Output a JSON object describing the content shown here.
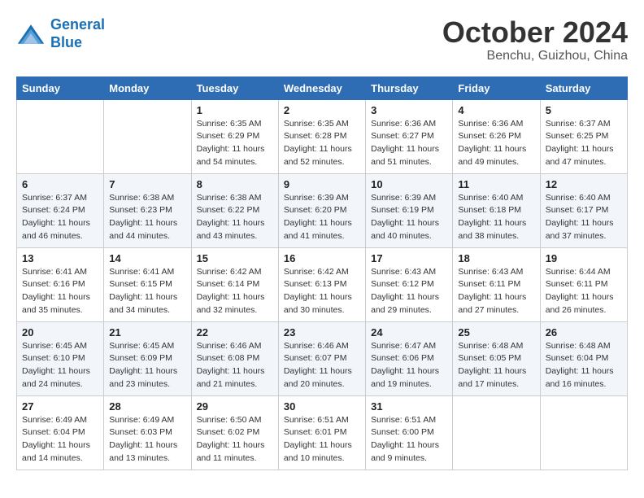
{
  "header": {
    "logo_line1": "General",
    "logo_line2": "Blue",
    "month": "October 2024",
    "location": "Benchu, Guizhou, China"
  },
  "weekdays": [
    "Sunday",
    "Monday",
    "Tuesday",
    "Wednesday",
    "Thursday",
    "Friday",
    "Saturday"
  ],
  "weeks": [
    [
      {
        "day": "",
        "detail": ""
      },
      {
        "day": "",
        "detail": ""
      },
      {
        "day": "1",
        "detail": "Sunrise: 6:35 AM\nSunset: 6:29 PM\nDaylight: 11 hours and 54 minutes."
      },
      {
        "day": "2",
        "detail": "Sunrise: 6:35 AM\nSunset: 6:28 PM\nDaylight: 11 hours and 52 minutes."
      },
      {
        "day": "3",
        "detail": "Sunrise: 6:36 AM\nSunset: 6:27 PM\nDaylight: 11 hours and 51 minutes."
      },
      {
        "day": "4",
        "detail": "Sunrise: 6:36 AM\nSunset: 6:26 PM\nDaylight: 11 hours and 49 minutes."
      },
      {
        "day": "5",
        "detail": "Sunrise: 6:37 AM\nSunset: 6:25 PM\nDaylight: 11 hours and 47 minutes."
      }
    ],
    [
      {
        "day": "6",
        "detail": "Sunrise: 6:37 AM\nSunset: 6:24 PM\nDaylight: 11 hours and 46 minutes."
      },
      {
        "day": "7",
        "detail": "Sunrise: 6:38 AM\nSunset: 6:23 PM\nDaylight: 11 hours and 44 minutes."
      },
      {
        "day": "8",
        "detail": "Sunrise: 6:38 AM\nSunset: 6:22 PM\nDaylight: 11 hours and 43 minutes."
      },
      {
        "day": "9",
        "detail": "Sunrise: 6:39 AM\nSunset: 6:20 PM\nDaylight: 11 hours and 41 minutes."
      },
      {
        "day": "10",
        "detail": "Sunrise: 6:39 AM\nSunset: 6:19 PM\nDaylight: 11 hours and 40 minutes."
      },
      {
        "day": "11",
        "detail": "Sunrise: 6:40 AM\nSunset: 6:18 PM\nDaylight: 11 hours and 38 minutes."
      },
      {
        "day": "12",
        "detail": "Sunrise: 6:40 AM\nSunset: 6:17 PM\nDaylight: 11 hours and 37 minutes."
      }
    ],
    [
      {
        "day": "13",
        "detail": "Sunrise: 6:41 AM\nSunset: 6:16 PM\nDaylight: 11 hours and 35 minutes."
      },
      {
        "day": "14",
        "detail": "Sunrise: 6:41 AM\nSunset: 6:15 PM\nDaylight: 11 hours and 34 minutes."
      },
      {
        "day": "15",
        "detail": "Sunrise: 6:42 AM\nSunset: 6:14 PM\nDaylight: 11 hours and 32 minutes."
      },
      {
        "day": "16",
        "detail": "Sunrise: 6:42 AM\nSunset: 6:13 PM\nDaylight: 11 hours and 30 minutes."
      },
      {
        "day": "17",
        "detail": "Sunrise: 6:43 AM\nSunset: 6:12 PM\nDaylight: 11 hours and 29 minutes."
      },
      {
        "day": "18",
        "detail": "Sunrise: 6:43 AM\nSunset: 6:11 PM\nDaylight: 11 hours and 27 minutes."
      },
      {
        "day": "19",
        "detail": "Sunrise: 6:44 AM\nSunset: 6:11 PM\nDaylight: 11 hours and 26 minutes."
      }
    ],
    [
      {
        "day": "20",
        "detail": "Sunrise: 6:45 AM\nSunset: 6:10 PM\nDaylight: 11 hours and 24 minutes."
      },
      {
        "day": "21",
        "detail": "Sunrise: 6:45 AM\nSunset: 6:09 PM\nDaylight: 11 hours and 23 minutes."
      },
      {
        "day": "22",
        "detail": "Sunrise: 6:46 AM\nSunset: 6:08 PM\nDaylight: 11 hours and 21 minutes."
      },
      {
        "day": "23",
        "detail": "Sunrise: 6:46 AM\nSunset: 6:07 PM\nDaylight: 11 hours and 20 minutes."
      },
      {
        "day": "24",
        "detail": "Sunrise: 6:47 AM\nSunset: 6:06 PM\nDaylight: 11 hours and 19 minutes."
      },
      {
        "day": "25",
        "detail": "Sunrise: 6:48 AM\nSunset: 6:05 PM\nDaylight: 11 hours and 17 minutes."
      },
      {
        "day": "26",
        "detail": "Sunrise: 6:48 AM\nSunset: 6:04 PM\nDaylight: 11 hours and 16 minutes."
      }
    ],
    [
      {
        "day": "27",
        "detail": "Sunrise: 6:49 AM\nSunset: 6:04 PM\nDaylight: 11 hours and 14 minutes."
      },
      {
        "day": "28",
        "detail": "Sunrise: 6:49 AM\nSunset: 6:03 PM\nDaylight: 11 hours and 13 minutes."
      },
      {
        "day": "29",
        "detail": "Sunrise: 6:50 AM\nSunset: 6:02 PM\nDaylight: 11 hours and 11 minutes."
      },
      {
        "day": "30",
        "detail": "Sunrise: 6:51 AM\nSunset: 6:01 PM\nDaylight: 11 hours and 10 minutes."
      },
      {
        "day": "31",
        "detail": "Sunrise: 6:51 AM\nSunset: 6:00 PM\nDaylight: 11 hours and 9 minutes."
      },
      {
        "day": "",
        "detail": ""
      },
      {
        "day": "",
        "detail": ""
      }
    ]
  ]
}
